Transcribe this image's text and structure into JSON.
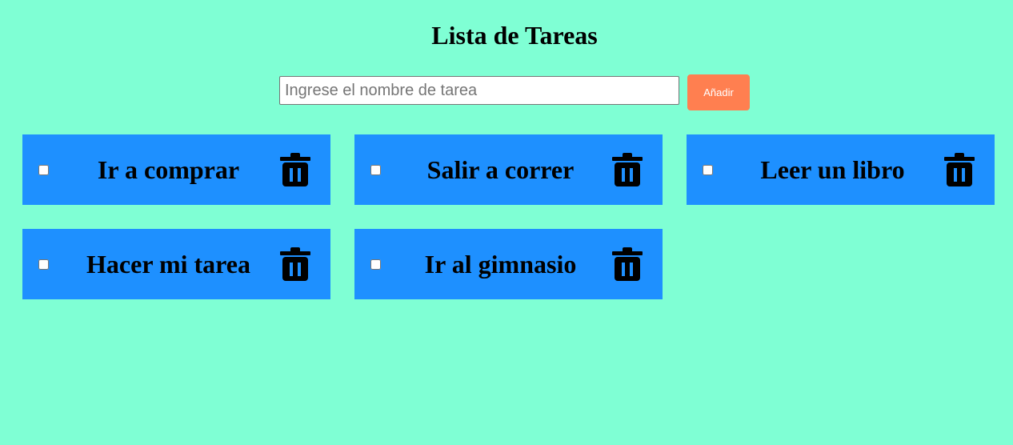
{
  "header": {
    "title": "Lista de Tareas"
  },
  "form": {
    "input_value": "",
    "input_placeholder": "Ingrese el nombre de tarea",
    "add_button_label": "Añadir"
  },
  "tasks": [
    {
      "label": "Ir a comprar",
      "checked": false,
      "delete_icon": "trash-icon"
    },
    {
      "label": "Salir a correr",
      "checked": false,
      "delete_icon": "trash-icon"
    },
    {
      "label": "Leer un libro",
      "checked": false,
      "delete_icon": "trash-icon"
    },
    {
      "label": "Hacer mi tarea",
      "checked": false,
      "delete_icon": "trash-icon"
    },
    {
      "label": "Ir al gimnasio",
      "checked": false,
      "delete_icon": "trash-icon"
    }
  ],
  "colors": {
    "background": "#7fffd4",
    "card": "#1e90ff",
    "add_button": "#ff7f50",
    "text": "#000000"
  }
}
